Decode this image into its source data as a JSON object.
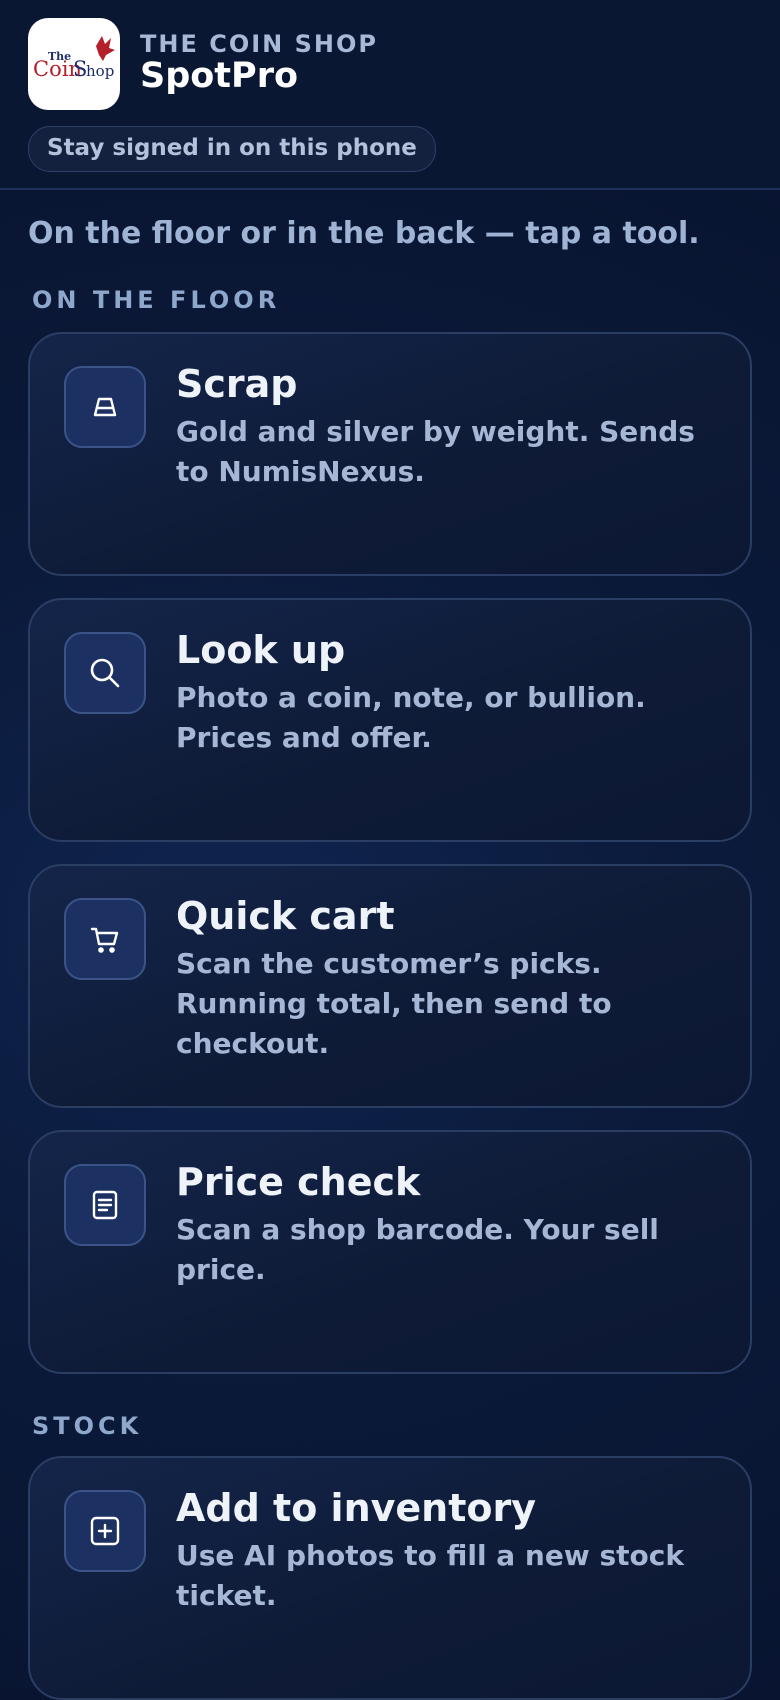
{
  "header": {
    "logo_text": "The CoinShop",
    "shop_name": "THE COIN SHOP",
    "app_name": "SpotPro",
    "stay_signed_in_label": "Stay signed in on this phone"
  },
  "tagline": "On the floor or in the back — tap a tool.",
  "sections": {
    "floor": {
      "label": "ON THE FLOOR",
      "cards": [
        {
          "icon": "scale-icon",
          "title": "Scrap",
          "description": "Gold and silver by weight. Sends to NumisNexus."
        },
        {
          "icon": "search-icon",
          "title": "Look up",
          "description": "Photo a coin, note, or bullion. Prices and offer."
        },
        {
          "icon": "cart-icon",
          "title": "Quick cart",
          "description": "Scan the customer’s picks. Running total, then send to checkout."
        },
        {
          "icon": "receipt-icon",
          "title": "Price check",
          "description": "Scan a shop barcode. Your sell price."
        }
      ]
    },
    "stock": {
      "label": "STOCK",
      "cards": [
        {
          "icon": "add-box-icon",
          "title": "Add to inventory",
          "description": "Use AI photos to fill a new stock ticket."
        }
      ]
    }
  },
  "colors": {
    "background": "#0b1a3a",
    "card_border": "#2a3d63",
    "icon_tile": "#1c3162",
    "title_text": "#eef2f9",
    "muted_text": "#a6b7d6",
    "logo_red": "#b3202a",
    "logo_navy": "#1c2d6b"
  }
}
